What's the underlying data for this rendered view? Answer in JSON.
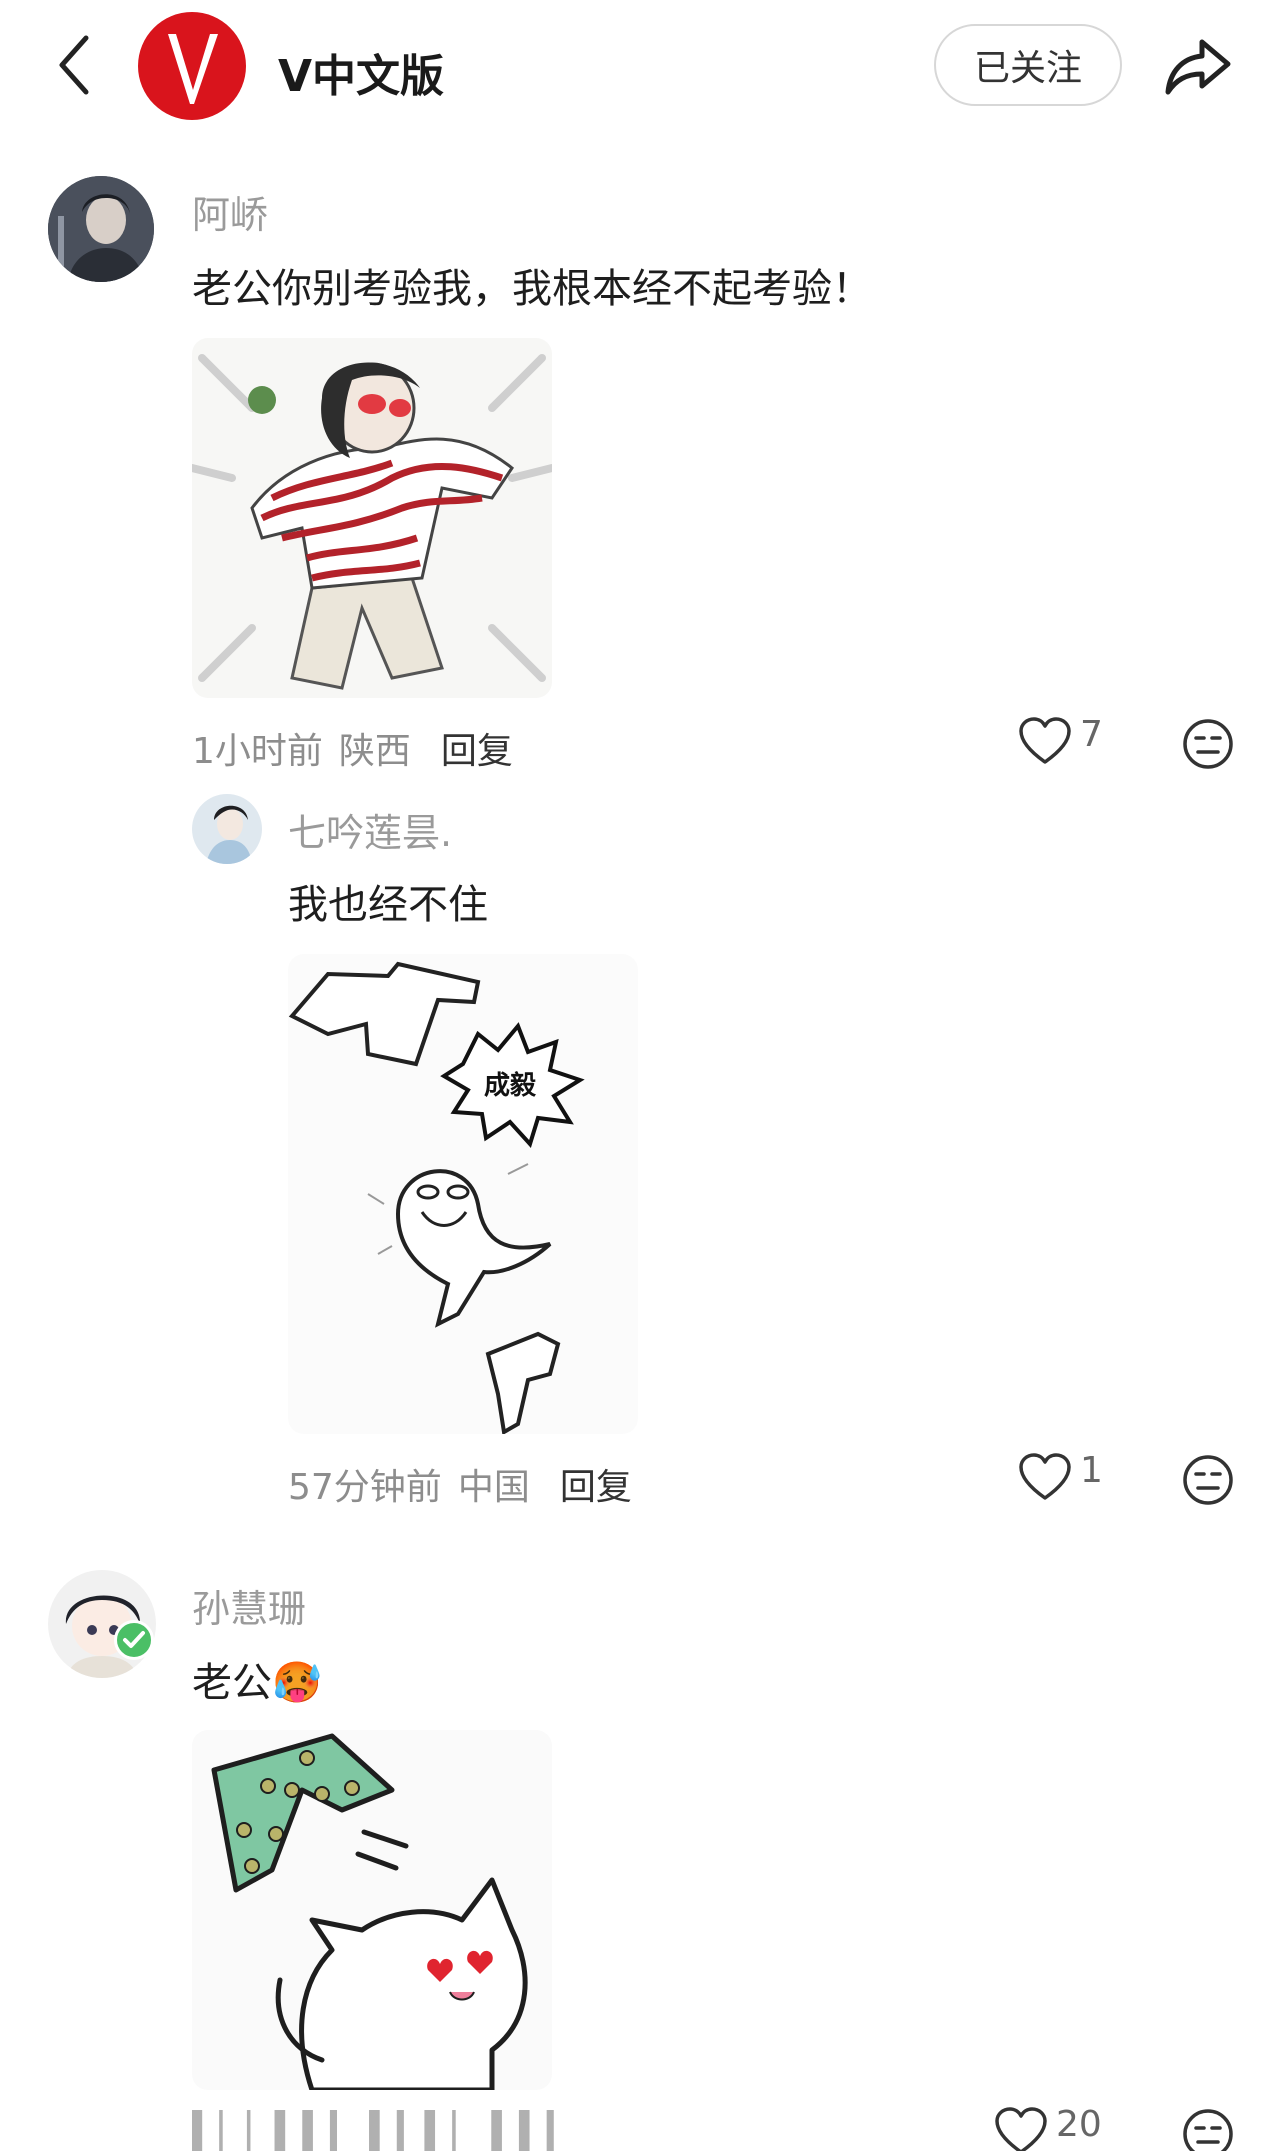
{
  "header": {
    "account_name": "V中文版",
    "follow_label": "已关注",
    "logo_letter": "V"
  },
  "comments": [
    {
      "username": "阿峤",
      "text": "老公你别考验我，我根本经不起考验！",
      "time": "1小时前",
      "location": "陕西",
      "reply_label": "回复",
      "likes": "7",
      "sticker": "cartoon-girl-striped-sweater"
    },
    {
      "username": "七吟莲昙.",
      "text": "我也经不住",
      "time": "57分钟前",
      "location": "中国",
      "reply_label": "回复",
      "likes": "1",
      "sticker_text": "成毅",
      "is_reply": true
    },
    {
      "username": "孙慧珊",
      "text": "老公",
      "emoji": "🥵",
      "likes": "20",
      "sticker": "cat-with-green-shorts",
      "verified": true
    }
  ],
  "colors": {
    "brand_red": "#d9141c",
    "username_gray": "#9a9a9a",
    "verified_green": "#4bbf66"
  }
}
